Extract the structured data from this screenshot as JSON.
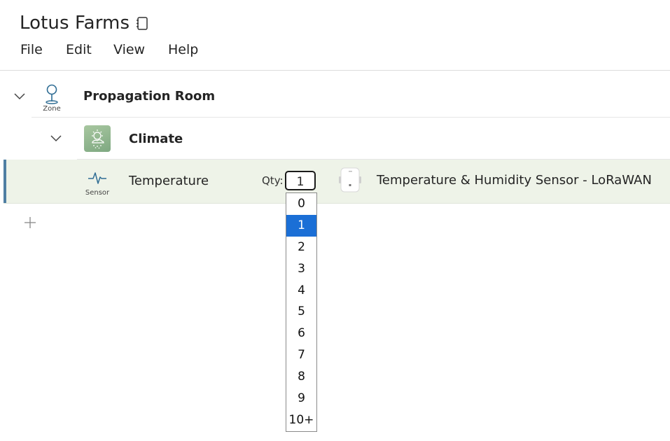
{
  "app": {
    "title": "Lotus Farms"
  },
  "menu": {
    "items": [
      {
        "label": "File"
      },
      {
        "label": "Edit"
      },
      {
        "label": "View"
      },
      {
        "label": "Help"
      }
    ]
  },
  "tree": {
    "zone": {
      "type_label": "Zone",
      "name": "Propagation Room",
      "icon": "location-pin-icon"
    },
    "group": {
      "name": "Climate",
      "icon": "climate-weather-icon"
    },
    "sensor": {
      "type_label": "Sensor",
      "name": "Temperature",
      "icon": "pulse-icon",
      "qty_label": "Qty:",
      "qty_value": "1",
      "device_name": "Temperature & Humidity Sensor - LoRaWAN"
    }
  },
  "qty_dropdown": {
    "selected": "1",
    "options": [
      "0",
      "1",
      "2",
      "3",
      "4",
      "5",
      "6",
      "7",
      "8",
      "9",
      "10+"
    ]
  },
  "colors": {
    "accent": "#4f7fa3",
    "selected_row": "#eef3e8",
    "dropdown_highlight": "#1b6fd6"
  }
}
